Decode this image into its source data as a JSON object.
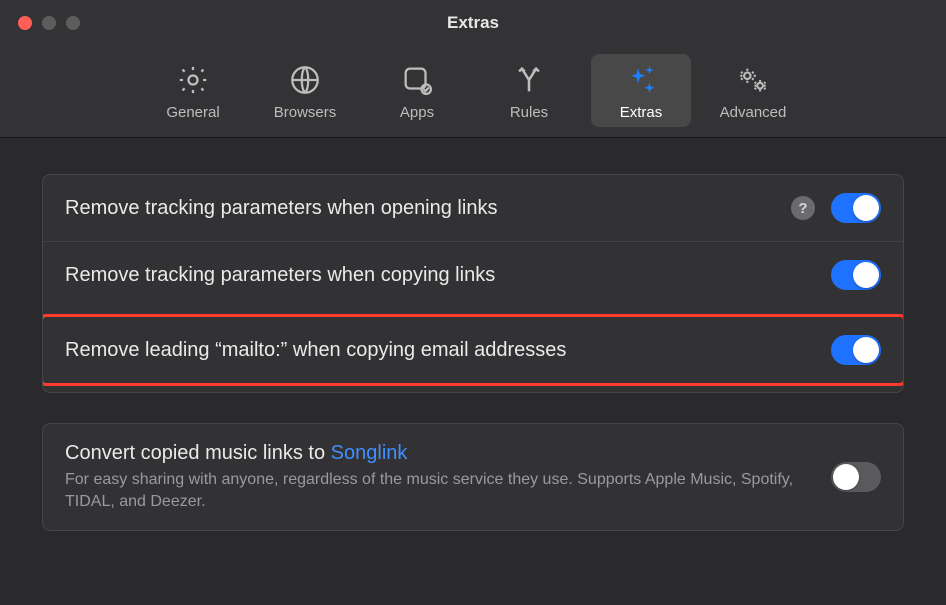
{
  "window": {
    "title": "Extras"
  },
  "tabs": {
    "general": "General",
    "browsers": "Browsers",
    "apps": "Apps",
    "rules": "Rules",
    "extras": "Extras",
    "advanced": "Advanced"
  },
  "rows": {
    "r1": {
      "label": "Remove tracking parameters when opening links",
      "help": "?",
      "on": true
    },
    "r2": {
      "label": "Remove tracking parameters when copying links",
      "on": true
    },
    "r3": {
      "label": "Remove leading “mailto:” when copying email addresses",
      "on": true
    },
    "r4": {
      "label_pre": "Convert copied music links to ",
      "link": "Songlink",
      "sub": "For easy sharing with anyone, regardless of the music service they use. Supports Apple Music, Spotify, TIDAL, and Deezer.",
      "on": false
    }
  }
}
